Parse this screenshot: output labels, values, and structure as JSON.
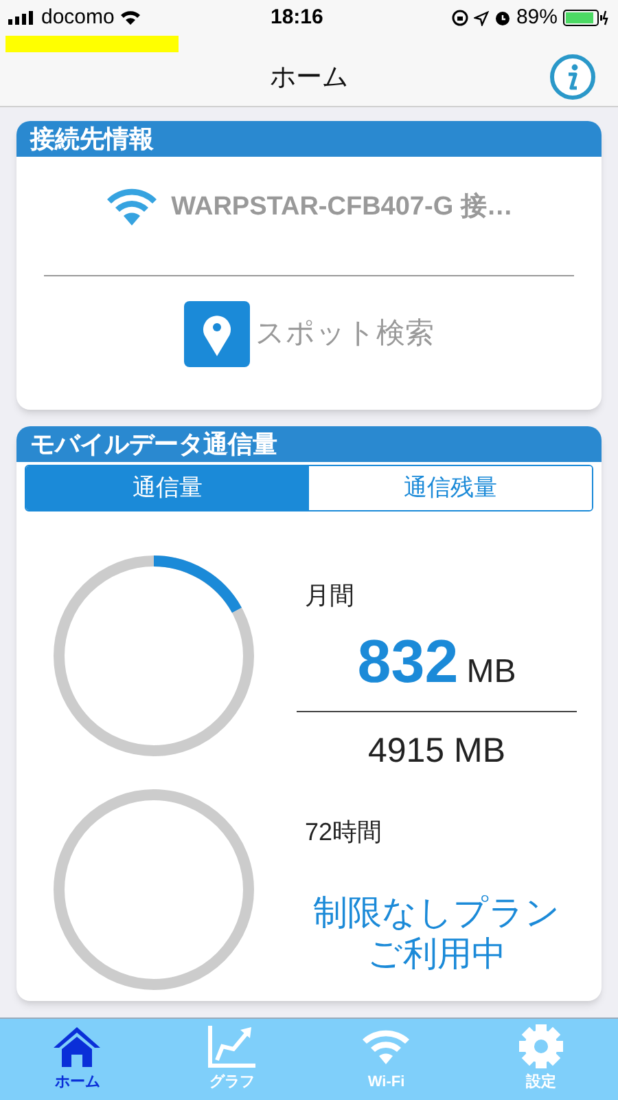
{
  "status_bar": {
    "carrier": "docomo",
    "time": "18:16",
    "battery": "89%"
  },
  "header": {
    "title": "ホーム"
  },
  "connection": {
    "title": "接続先情報",
    "network": "WARPSTAR-CFB407-G 接…",
    "spot_search": "スポット検索"
  },
  "usage": {
    "title": "モバイルデータ通信量",
    "tabs": [
      {
        "label": "通信量",
        "selected": true
      },
      {
        "label": "通信残量",
        "selected": false
      }
    ],
    "monthly": {
      "label": "月間",
      "used": "832",
      "used_unit": "MB",
      "limit": "4915 MB"
    },
    "three_day": {
      "label": "72時間",
      "note_lines": [
        "制限なしプラン",
        "ご利用中"
      ]
    }
  },
  "tab_bar": [
    {
      "label": "ホーム",
      "kind": "home",
      "selected": true
    },
    {
      "label": "グラフ",
      "kind": "graph",
      "selected": false
    },
    {
      "label": "Wi-Fi",
      "kind": "wifi",
      "selected": false
    },
    {
      "label": "設定",
      "kind": "settings",
      "selected": false
    }
  ]
}
